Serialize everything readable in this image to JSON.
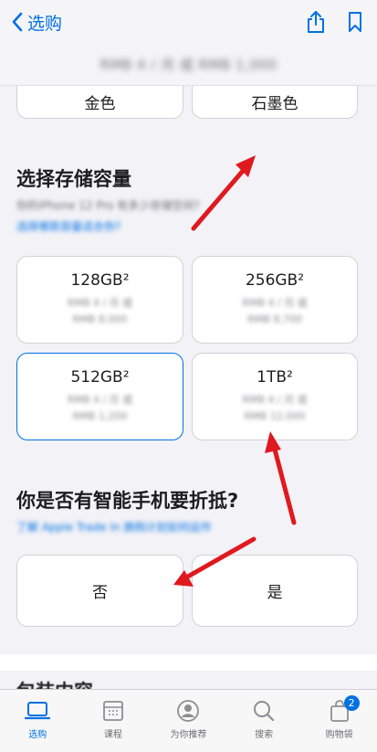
{
  "nav": {
    "back_label": "选购",
    "share_icon": "share-icon",
    "bookmark_icon": "bookmark-icon"
  },
  "price_bar": {
    "text": "RMB 4 / 月 或 RMB 1,000"
  },
  "finish": {
    "options": [
      "金色",
      "石墨色"
    ]
  },
  "storage": {
    "title": "选择存储容量",
    "note": "你的iPhone 12 Pro 有多少存储空间?",
    "link": "选择哪款容量适合你?",
    "options": [
      {
        "label": "128GB²",
        "sub1": "RMB 4 / 月 或",
        "sub2": "RMB 8,000"
      },
      {
        "label": "256GB²",
        "sub1": "RMB 4 / 月 或",
        "sub2": "RMB 8,700"
      },
      {
        "label": "512GB²",
        "sub1": "RMB 4 / 月 或",
        "sub2": "RMB 1,200"
      },
      {
        "label": "1TB²",
        "sub1": "RMB 4 / 月 或",
        "sub2": "RMB 12,000"
      }
    ]
  },
  "tradein": {
    "title": "你是否有智能手机要折抵?",
    "link": "了解 Apple Trade In 换购计划如何运作",
    "options": [
      "否",
      "是"
    ]
  },
  "next_section": {
    "title": "包装内容"
  },
  "tabbar": {
    "items": [
      {
        "label": "选购",
        "icon": "laptop-icon"
      },
      {
        "label": "课程",
        "icon": "calendar-icon"
      },
      {
        "label": "为你推荐",
        "icon": "person-icon"
      },
      {
        "label": "搜索",
        "icon": "search-icon"
      },
      {
        "label": "购物袋",
        "icon": "bag-icon",
        "badge": "2"
      }
    ]
  },
  "colors": {
    "accent": "#0071e3",
    "arrow": "#e0191e"
  }
}
